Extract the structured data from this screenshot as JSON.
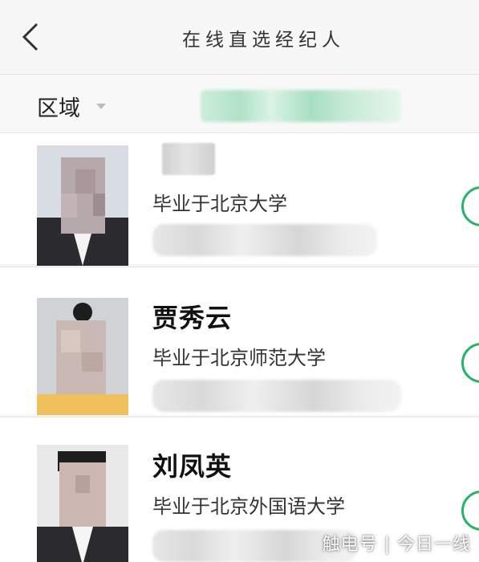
{
  "header": {
    "title": "在线直选经纪人"
  },
  "filters": {
    "region_label": "区域"
  },
  "agents": [
    {
      "name": "",
      "school": "毕业于北京大学"
    },
    {
      "name": "贾秀云",
      "school": "毕业于北京师范大学"
    },
    {
      "name": "刘凤英",
      "school": "毕业于北京外国语大学"
    }
  ],
  "watermark": "触电号 | 今日一线",
  "colors": {
    "accent_green": "#25b36a"
  },
  "icons": {
    "back": "chevron-left-icon",
    "dropdown": "caret-down-icon"
  }
}
